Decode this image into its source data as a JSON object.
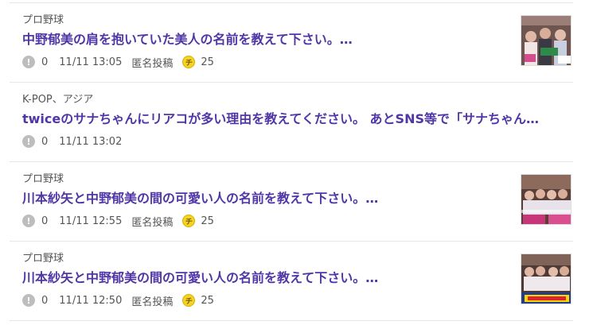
{
  "questions": [
    {
      "category": "プロ野球",
      "title": "中野郁美の肩を抱いていた美人の名前を教えて下さい。…",
      "answers": "0",
      "timestamp": "11/11 13:05",
      "anonymous": "匿名投稿",
      "coin_symbol": "チ",
      "coins": "25",
      "thumbnail_icon": "question-thumbnail"
    },
    {
      "category": "K-POP、アジア",
      "title": "twiceのサナちゃんにリアコが多い理由を教えてください。 あとSNS等で「サナちゃん…",
      "answers": "0",
      "timestamp": "11/11 13:02"
    },
    {
      "category": "プロ野球",
      "title": "川本紗矢と中野郁美の間の可愛い人の名前を教えて下さい。…",
      "answers": "0",
      "timestamp": "11/11 12:55",
      "anonymous": "匿名投稿",
      "coin_symbol": "チ",
      "coins": "25",
      "thumbnail_icon": "question-thumbnail"
    },
    {
      "category": "プロ野球",
      "title": "川本紗矢と中野郁美の間の可愛い人の名前を教えて下さい。…",
      "answers": "0",
      "timestamp": "11/11 12:50",
      "anonymous": "匿名投稿",
      "coin_symbol": "チ",
      "coins": "25",
      "thumbnail_icon": "question-thumbnail"
    }
  ],
  "icons": {
    "answer_icon_glyph": "!"
  },
  "colors": {
    "title": "#5036a6",
    "coin": "#f4d226",
    "answer_icon": "#bdbdbd"
  }
}
